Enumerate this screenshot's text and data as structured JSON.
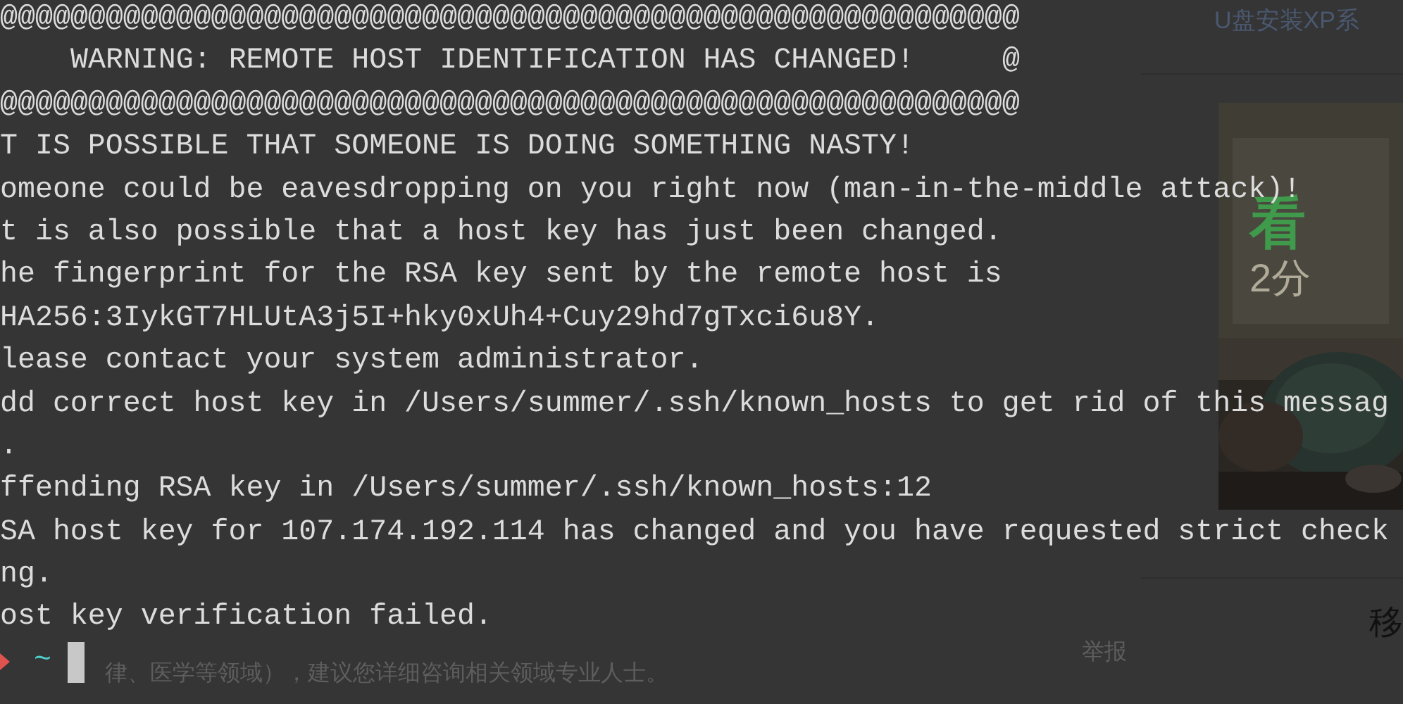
{
  "terminal": {
    "lines": [
      {
        "kind": "text",
        "text": "@@@@@@@@@@@@@@@@@@@@@@@@@@@@@@@@@@@@@@@@@@@@@@@@@@@@@@@@@@"
      },
      {
        "kind": "banner",
        "text": "WARNING: REMOTE HOST IDENTIFICATION HAS CHANGED!     @"
      },
      {
        "kind": "text",
        "text": "@@@@@@@@@@@@@@@@@@@@@@@@@@@@@@@@@@@@@@@@@@@@@@@@@@@@@@@@@@"
      },
      {
        "kind": "text",
        "text": "T IS POSSIBLE THAT SOMEONE IS DOING SOMETHING NASTY!"
      },
      {
        "kind": "text",
        "text": "omeone could be eavesdropping on you right now (man-in-the-middle attack)!"
      },
      {
        "kind": "text",
        "text": "t is also possible that a host key has just been changed."
      },
      {
        "kind": "text",
        "text": "he fingerprint for the RSA key sent by the remote host is"
      },
      {
        "kind": "text",
        "text": "HA256:3IykGT7HLUtA3j5I+hky0xUh4+Cuy29hd7gTxci6u8Y."
      },
      {
        "kind": "text",
        "text": "lease contact your system administrator."
      },
      {
        "kind": "text",
        "text": "dd correct host key in /Users/summer/.ssh/known_hosts to get rid of this messag"
      },
      {
        "kind": "text",
        "text": "."
      },
      {
        "kind": "text",
        "text": "ffending RSA key in /Users/summer/.ssh/known_hosts:12"
      },
      {
        "kind": "text",
        "text": "SA host key for 107.174.192.114 has changed and you have requested strict check"
      },
      {
        "kind": "text",
        "text": "ng."
      },
      {
        "kind": "text",
        "text": "ost key verification failed."
      }
    ],
    "prompt": {
      "path": "~"
    }
  },
  "page": {
    "sidebar_title": "U盘安装XP系",
    "ad": {
      "headline": "看",
      "subline": "2分"
    },
    "report_link": "举报",
    "right_heading": "移",
    "disclaimer": "律、医学等领域），建议您详细咨询相关领域专业人士。"
  }
}
